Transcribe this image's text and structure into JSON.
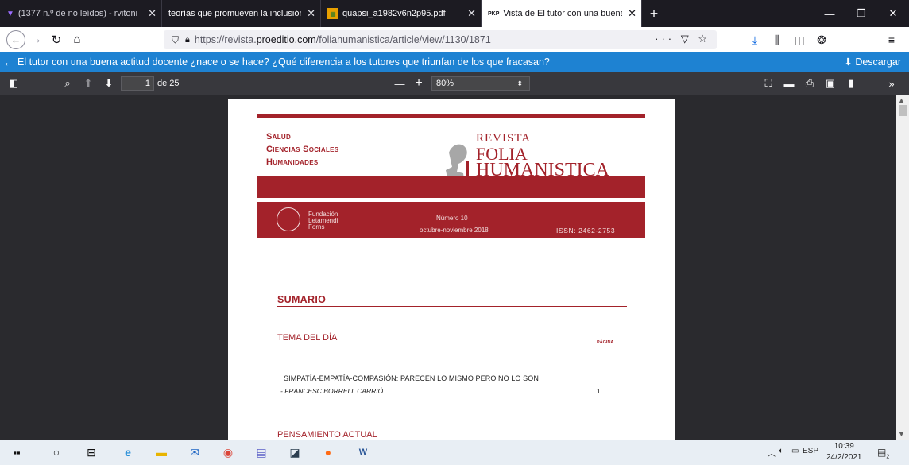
{
  "tabs": [
    {
      "label": "(1377 n.º de no leídos) - rvitoni",
      "icon": "mail-icon",
      "color": "#7b3ff2"
    },
    {
      "label": "teorías que promueven la inclusión",
      "icon": "",
      "color": ""
    },
    {
      "label": "quapsi_a1982v6n2p95.pdf",
      "icon": "pdf-icon",
      "color": "#e8a000"
    },
    {
      "label": "Vista de El tutor con una buena",
      "icon": "PKP",
      "color": ""
    }
  ],
  "active_tab": 3,
  "nav": {
    "url_prefix": "https://revista.",
    "url_domain": "proeditio.com",
    "url_suffix": "/foliahumanistica/article/view/1130/1871",
    "page_actions": "··· ▽ ☆"
  },
  "pkp": {
    "title": "El tutor con una buena actitud docente ¿nace o se hace? ¿Qué diferencia a los tutores que triunfan de los que fracasan?",
    "download_label": "Descargar"
  },
  "pdf": {
    "page_current": "1",
    "page_total": "de 25",
    "zoom": "80%"
  },
  "doc": {
    "subject_1": "Salud",
    "subject_2": "Ciencias Sociales",
    "subject_3": "Humanidades",
    "logo_line1": "REVISTA",
    "logo_line2": "FOLIA",
    "logo_line3": "HUMANISTICA",
    "fundacion_1": "Fundación",
    "fundacion_2": "Letamendi",
    "fundacion_3": "Forns",
    "numero": "Número 10",
    "fecha": "octubre-noviembre 2018",
    "issn": "ISSN: 2462-2753",
    "sumario": "SUMARIO",
    "tema": "TEMA DEL DÍA",
    "pagina": "PÁGINA",
    "article_title": "SIMPATÍA-EMPATÍA-COMPASIÓN: PARECEN LO  MISMO PERO NO LO SON",
    "article_author": "- FRANCESC BORRELL CARRIÓ",
    "article_page": "1",
    "pensamiento": "PENSAMIENTO ACTUAL",
    "brand_color": "#a3222a"
  },
  "taskbar": {
    "lang": "ESP",
    "time": "10:39",
    "date": "24/2/2021",
    "notif_count": "2"
  }
}
